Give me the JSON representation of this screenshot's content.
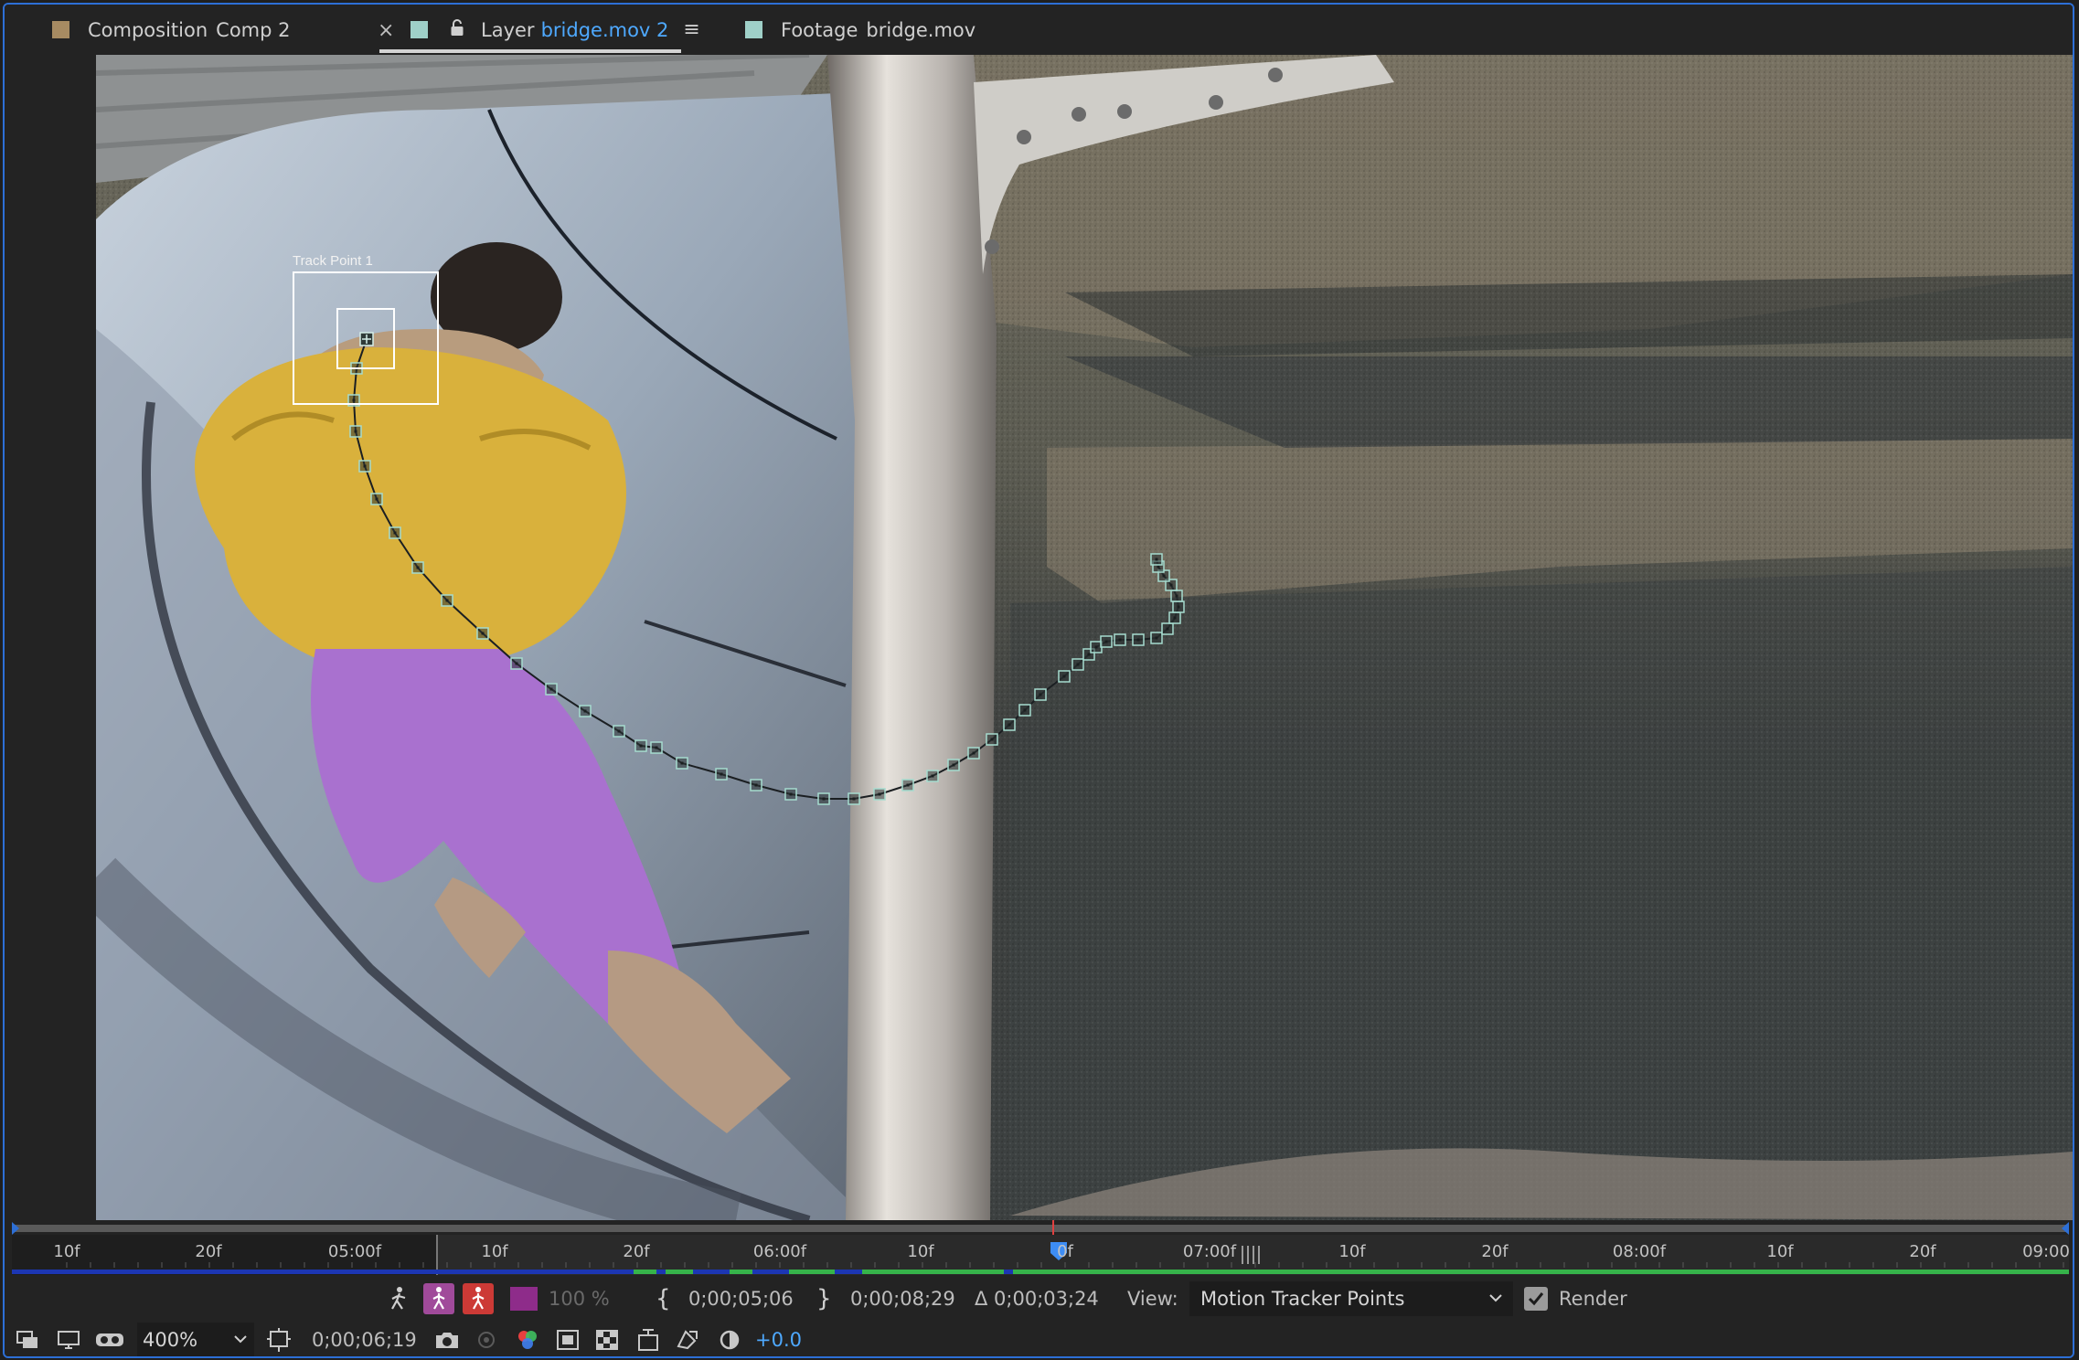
{
  "tabs": [
    {
      "prefix": "Composition",
      "name": "Comp 2",
      "swatch": "#a78b62",
      "active": false
    },
    {
      "prefix": "Layer",
      "name": "bridge.mov 2",
      "swatch": "#9fd0c8",
      "active": true
    },
    {
      "prefix": "Footage",
      "name": "bridge.mov",
      "swatch": "#9fd0c8",
      "active": false
    }
  ],
  "tab_close_glyph": "×",
  "tab_menu_glyph": "≡",
  "viewer": {
    "track_point_label": "Track Point 1",
    "track_color": "#a6dccf"
  },
  "ruler": {
    "ticks": [
      "10f",
      "20f",
      "05:00f",
      "10f",
      "20f",
      "06:00f",
      "10f",
      "0f",
      "07:00f",
      "10f",
      "20f",
      "08:00f",
      "10f",
      "20f",
      "09:00"
    ],
    "work_area_color": "#36b34a",
    "cache_color": "#2a4dd6",
    "playhead_color": "#3d8df5"
  },
  "controls": {
    "opacity_label": "100 %",
    "in_point": "0;00;05;06",
    "out_point": "0;00;08;29",
    "duration": "Δ 0;00;03;24",
    "view_label": "View:",
    "view_value": "Motion Tracker Points",
    "render_label": "Render",
    "render_checked": true,
    "zoom_value": "400%",
    "current_time": "0;00;06;19",
    "exposure_value": "+0.0"
  }
}
